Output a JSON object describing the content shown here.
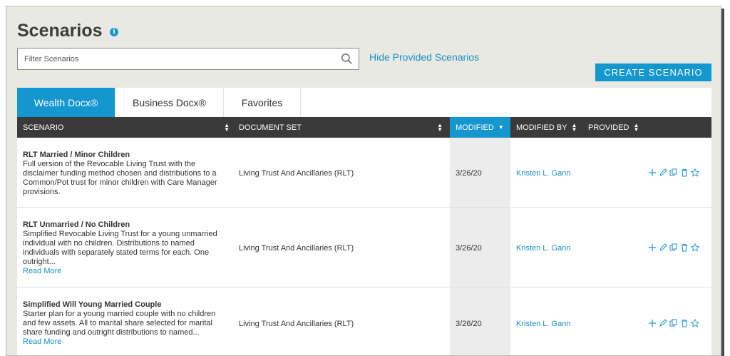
{
  "page": {
    "title": "Scenarios",
    "info_icon": "i"
  },
  "filter": {
    "placeholder": "Filter Scenarios",
    "value": ""
  },
  "hide_link": "Hide Provided Scenarios",
  "create_button": "CREATE SCENARIO",
  "tabs": [
    {
      "label": "Wealth Docx®",
      "active": true
    },
    {
      "label": "Business Docx®",
      "active": false
    },
    {
      "label": "Favorites",
      "active": false
    }
  ],
  "columns": {
    "scenario": "SCENARIO",
    "document_set": "DOCUMENT SET",
    "modified": "MODIFIED",
    "modified_by": "MODIFIED BY",
    "provided": "PROVIDED"
  },
  "rows": [
    {
      "title": "RLT Married / Minor Children",
      "desc_lines": [
        "Full version of the Revocable Living Trust with the",
        "disclaimer funding method chosen and distributions to a",
        "Common/Pot trust for minor children with Care Manager",
        "provisions."
      ],
      "read_more": "",
      "document_set": "Living Trust And Ancillaries (RLT)",
      "modified": "3/26/20",
      "modified_by": "Kristen L. Gann"
    },
    {
      "title": "RLT Unmarried / No Children",
      "desc_lines": [
        "Simplified Revocable Living Trust for a young unmarried",
        "individual with no children. Distributions to named",
        "individuals with separately stated terms for each. One",
        "outright..."
      ],
      "read_more": "Read More",
      "document_set": "Living Trust And Ancillaries (RLT)",
      "modified": "3/26/20",
      "modified_by": "Kristen L. Gann"
    },
    {
      "title": "Simplified Will Young Married Couple",
      "desc_lines": [
        "Starter plan for a young married couple with no children",
        "and few assets. All to marital share selected for marital",
        "share funding and outright distributions to named..."
      ],
      "read_more": "Read More",
      "document_set": "Living Trust And Ancillaries (RLT)",
      "modified": "3/26/20",
      "modified_by": "Kristen L. Gann"
    }
  ],
  "colors": {
    "accent": "#1496cf",
    "header_bg": "#3a3a3a",
    "page_bg": "#e9e9e4"
  },
  "icons": [
    "info-icon",
    "search-icon",
    "sort-icon",
    "add-icon",
    "edit-icon",
    "copy-icon",
    "delete-icon",
    "favorite-star-icon"
  ]
}
